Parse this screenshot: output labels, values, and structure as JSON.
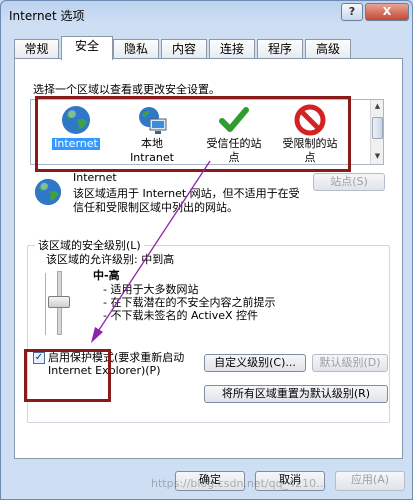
{
  "window": {
    "title": "Internet 选项",
    "help": "?",
    "close": "X"
  },
  "tabs": [
    {
      "label": "常规"
    },
    {
      "label": "安全"
    },
    {
      "label": "隐私"
    },
    {
      "label": "内容"
    },
    {
      "label": "连接"
    },
    {
      "label": "程序"
    },
    {
      "label": "高级"
    }
  ],
  "security": {
    "instruction": "选择一个区域以查看或更改安全设置。",
    "zones": [
      {
        "label": "Internet",
        "icon": "globe-icon",
        "selected": true
      },
      {
        "label": "本地 Intranet",
        "label_line1": "本地",
        "label_line2": "Intranet",
        "icon": "computer-network-icon"
      },
      {
        "label": "受信任的站点",
        "label_line1": "受信任的站",
        "label_line2": "点",
        "icon": "green-check-icon"
      },
      {
        "label": "受限制的站点",
        "label_line1": "受限制的站",
        "label_line2": "点",
        "icon": "red-block-icon"
      }
    ],
    "zone_name": "Internet",
    "zone_description": "该区域适用于 Internet 网站，但不适用于在受信任和受限制区域中列出的网站。",
    "sites_button": "站点(S)",
    "level_group": "该区域的安全级别(L)",
    "allowed_levels": "该区域的允许级别: 中到高",
    "level_name": "中-高",
    "level_bullets": [
      "- 适用于大多数网站",
      "- 在下载潜在的不安全内容之前提示",
      "- 不下载未签名的 ActiveX 控件"
    ],
    "protected_mode_label": "启用保护模式(要求重新启动 Internet Explorer)(P)",
    "protected_mode_line1": "启用保护模式(要求重新启动",
    "protected_mode_line2": "Internet Explorer)(P)",
    "protected_mode_checked": true,
    "custom_level_button": "自定义级别(C)...",
    "default_level_button": "默认级别(D)",
    "reset_all_button": "将所有区域重置为默认级别(R)"
  },
  "footer": {
    "ok": "确定",
    "cancel": "取消",
    "apply": "应用(A)"
  },
  "watermark": "https://blog.csdn.net/qq_4210...",
  "colors": {
    "highlight_box": "#8b1a1a",
    "arrow": "#8e24aa",
    "selection": "#3399ff"
  }
}
